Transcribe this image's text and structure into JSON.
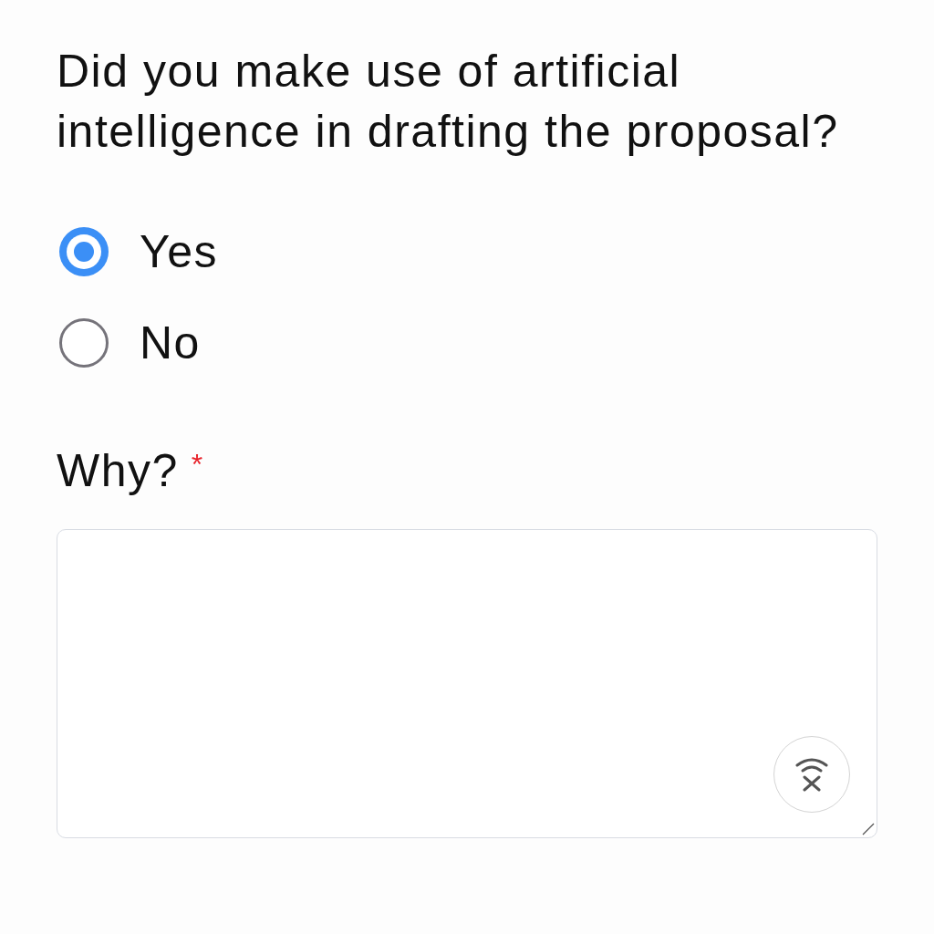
{
  "question": {
    "text": "Did you make use of artificial intelligence in drafting the proposal?"
  },
  "options": [
    {
      "label": "Yes",
      "selected": true
    },
    {
      "label": "No",
      "selected": false
    }
  ],
  "follow_up": {
    "label": "Why?",
    "required_mark": "*"
  }
}
